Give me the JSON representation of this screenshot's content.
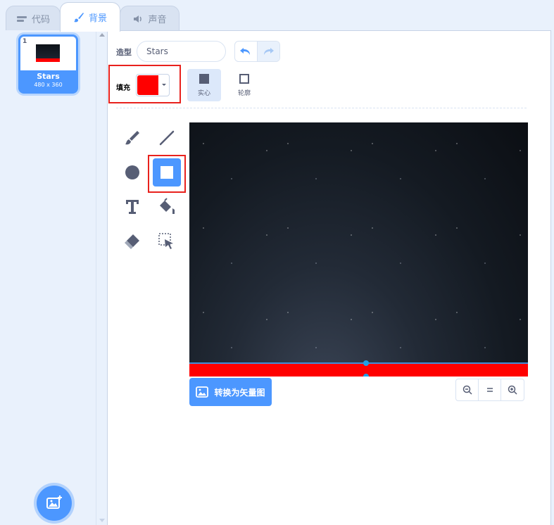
{
  "tabs": [
    {
      "label": "代码",
      "icon": "code-icon"
    },
    {
      "label": "背景",
      "icon": "brush-icon"
    },
    {
      "label": "声音",
      "icon": "speaker-icon"
    }
  ],
  "costume_list": {
    "items": [
      {
        "index": "1",
        "name": "Stars",
        "size": "480 x 360"
      }
    ]
  },
  "editor": {
    "costume_label": "造型",
    "costume_name": "Stars",
    "fill_label": "填充",
    "fill_color": "#ff0000",
    "mode_solid_label": "实心",
    "mode_outline_label": "轮廓",
    "convert_label": "转换为矢量图"
  },
  "colors": {
    "accent": "#4c97ff",
    "highlight": "#e8211d"
  }
}
